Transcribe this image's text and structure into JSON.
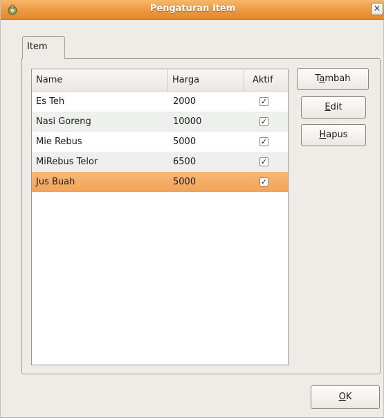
{
  "window": {
    "title": "Pengaturan Item",
    "close_label": "×"
  },
  "tabs": [
    {
      "label": "Item",
      "active": true
    }
  ],
  "table": {
    "columns": [
      "Name",
      "Harga",
      "Aktif"
    ],
    "rows": [
      {
        "name": "Es Teh",
        "harga": "2000",
        "aktif": true
      },
      {
        "name": "Nasi Goreng",
        "harga": "10000",
        "aktif": true
      },
      {
        "name": "Mie Rebus",
        "harga": "5000",
        "aktif": true
      },
      {
        "name": "MiRebus Telor",
        "harga": "6500",
        "aktif": true
      },
      {
        "name": "Jus Buah",
        "harga": "5000",
        "aktif": true,
        "selected": true
      }
    ],
    "check_glyph": "✓"
  },
  "buttons": {
    "tambah": {
      "pre": "T",
      "mnemonic": "a",
      "post": "mbah"
    },
    "edit": {
      "pre": "",
      "mnemonic": "E",
      "post": "dit"
    },
    "hapus": {
      "pre": "",
      "mnemonic": "H",
      "post": "apus"
    },
    "ok": {
      "pre": "",
      "mnemonic": "O",
      "post": "K"
    }
  },
  "colors": {
    "titlebar": "#ef9c45",
    "selected_row": "#f3a35a",
    "alt_row": "#edf0ec",
    "window_bg": "#efebe7"
  },
  "icons": {
    "app": "app-icon",
    "close": "close-icon",
    "check": "check-icon"
  }
}
